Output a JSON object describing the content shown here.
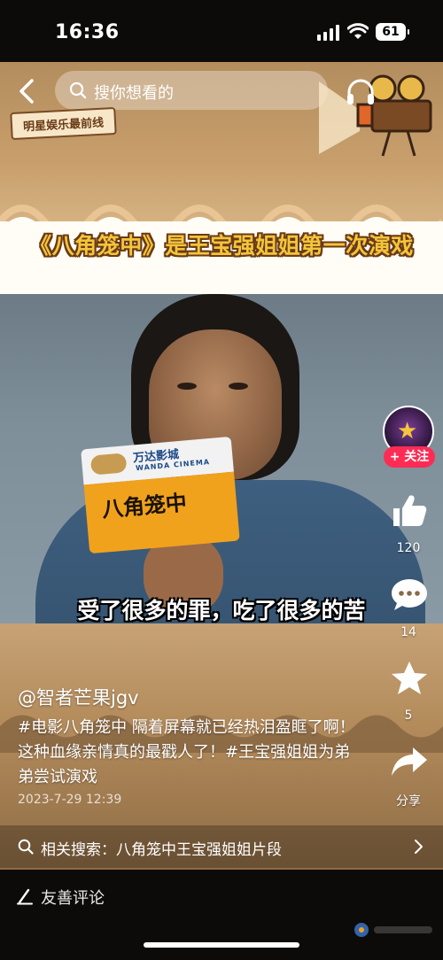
{
  "status_bar": {
    "time": "16:36",
    "battery": "61"
  },
  "top": {
    "search_placeholder": "搜你想看的",
    "tag": "明星娱乐最前线"
  },
  "video": {
    "headline": "《八角笼中》是王宝强姐姐第一次演戏",
    "mic_brand": "万达影城",
    "mic_brand_en": "WANDA CINEMA",
    "mic_title": "八角笼中",
    "subtitle": "受了很多的罪，吃了很多的苦"
  },
  "rail": {
    "follow_label": "+ 关注",
    "likes": "120",
    "comments": "14",
    "favorites": "5",
    "share_label": "分享"
  },
  "caption": {
    "author": "@智者芒果jgv",
    "description": "#电影八角笼中 隔着屏幕就已经热泪盈眶了啊！这种血缘亲情真的最戳人了！#王宝强姐姐为弟弟尝试演戏",
    "date": "2023-7-29 12:39"
  },
  "related": {
    "text": "相关搜索：八角笼中王宝强姐姐片段"
  },
  "comment_bar": {
    "placeholder": "友善评论"
  },
  "colors": {
    "follow": "#fe2c55",
    "headline_fill": "#f3c53a",
    "headline_stroke": "#6a3a16",
    "band": "#c6a275"
  }
}
